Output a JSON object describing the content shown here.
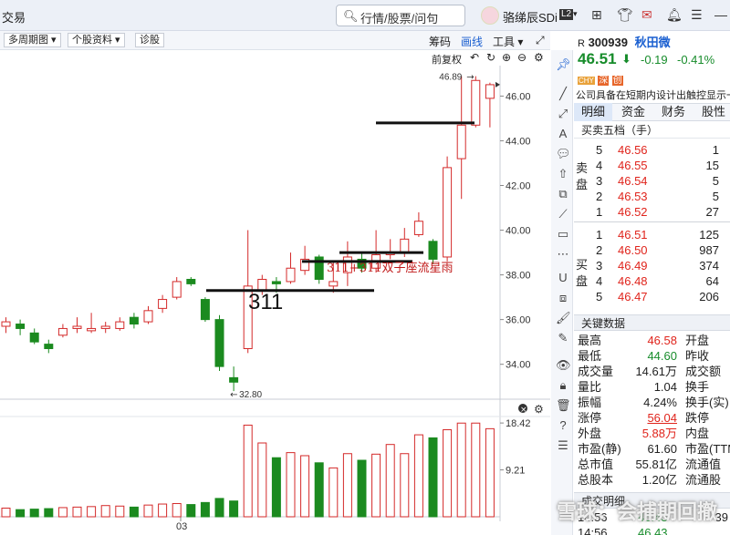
{
  "topbar": {
    "left_label": "交易",
    "search_placeholder": "行情/股票/问句",
    "user_name": "骆绨辰SDi",
    "level_badge": "L2"
  },
  "toolbar": {
    "period_label": "多周期图",
    "stock_info_label": "个股资料",
    "diagnose_label": "诊股",
    "chips_label": "筹码",
    "drawline_label": "画线",
    "tools_label": "工具",
    "fq_label": "前复权"
  },
  "chart_data": {
    "type": "candlestick",
    "y_ticks": [
      "46.00",
      "44.00",
      "42.00",
      "40.00",
      "38.00",
      "36.00",
      "34.00"
    ],
    "ylim": [
      32.6,
      47.2
    ],
    "candles": [
      {
        "o": 35.7,
        "c": 35.9,
        "h": 36.1,
        "l": 35.4
      },
      {
        "o": 35.8,
        "c": 35.6,
        "h": 36.0,
        "l": 35.3
      },
      {
        "o": 35.4,
        "c": 35.0,
        "h": 35.6,
        "l": 34.9
      },
      {
        "o": 34.9,
        "c": 34.7,
        "h": 35.1,
        "l": 34.5
      },
      {
        "o": 35.3,
        "c": 35.6,
        "h": 35.8,
        "l": 35.2
      },
      {
        "o": 35.6,
        "c": 35.7,
        "h": 36.1,
        "l": 35.4
      },
      {
        "o": 35.5,
        "c": 35.6,
        "h": 36.3,
        "l": 35.4
      },
      {
        "o": 35.6,
        "c": 35.7,
        "h": 35.9,
        "l": 35.4
      },
      {
        "o": 35.6,
        "c": 35.9,
        "h": 36.1,
        "l": 35.5
      },
      {
        "o": 36.1,
        "c": 35.8,
        "h": 36.3,
        "l": 35.6
      },
      {
        "o": 35.9,
        "c": 36.4,
        "h": 36.6,
        "l": 35.8
      },
      {
        "o": 36.5,
        "c": 36.9,
        "h": 37.1,
        "l": 36.3
      },
      {
        "o": 37.0,
        "c": 37.7,
        "h": 37.9,
        "l": 36.9
      },
      {
        "o": 37.8,
        "c": 37.6,
        "h": 37.9,
        "l": 37.5
      },
      {
        "o": 36.9,
        "c": 36.0,
        "h": 37.0,
        "l": 35.9
      },
      {
        "o": 36.0,
        "c": 33.9,
        "h": 36.2,
        "l": 33.7
      },
      {
        "o": 33.4,
        "c": 33.2,
        "h": 33.9,
        "l": 32.8
      },
      {
        "o": 34.7,
        "c": 37.5,
        "h": 40.0,
        "l": 34.5
      },
      {
        "o": 37.3,
        "c": 37.8,
        "h": 38.0,
        "l": 37.1
      },
      {
        "o": 37.7,
        "c": 37.6,
        "h": 37.9,
        "l": 37.2
      },
      {
        "o": 37.7,
        "c": 38.3,
        "h": 39.0,
        "l": 37.6
      },
      {
        "o": 38.2,
        "c": 38.7,
        "h": 39.3,
        "l": 38.0
      },
      {
        "o": 38.8,
        "c": 37.8,
        "h": 38.9,
        "l": 37.6
      },
      {
        "o": 37.5,
        "c": 37.7,
        "h": 38.6,
        "l": 37.2
      },
      {
        "o": 38.1,
        "c": 38.8,
        "h": 39.5,
        "l": 37.5
      },
      {
        "o": 38.7,
        "c": 38.3,
        "h": 39.0,
        "l": 38.1
      },
      {
        "o": 38.3,
        "c": 38.9,
        "h": 40.0,
        "l": 38.1
      },
      {
        "o": 38.9,
        "c": 39.0,
        "h": 39.6,
        "l": 38.7
      },
      {
        "o": 39.0,
        "c": 39.6,
        "h": 40.1,
        "l": 38.8
      },
      {
        "o": 39.8,
        "c": 40.4,
        "h": 40.8,
        "l": 39.7
      },
      {
        "o": 39.5,
        "c": 38.7,
        "h": 39.6,
        "l": 38.5
      },
      {
        "o": 38.8,
        "c": 42.8,
        "h": 43.3,
        "l": 38.6
      },
      {
        "o": 43.2,
        "c": 44.7,
        "h": 46.89,
        "l": 41.4
      },
      {
        "o": 44.7,
        "c": 46.7,
        "h": 46.89,
        "l": 44.6
      },
      {
        "o": 45.9,
        "c": 46.51,
        "h": 46.6,
        "l": 44.6
      }
    ],
    "volumes": [
      1.7,
      1.4,
      1.5,
      1.6,
      1.8,
      1.9,
      2.0,
      2.2,
      2.1,
      1.9,
      2.3,
      2.5,
      2.6,
      2.4,
      2.8,
      3.6,
      3.1,
      18.0,
      14.5,
      11.6,
      12.6,
      12.0,
      10.6,
      9.6,
      12.4,
      11.1,
      12.3,
      14.2,
      12.4,
      16.1,
      15.5,
      17.1,
      18.4,
      18.4,
      17.3
    ],
    "volume_ticks": [
      "18.42",
      "9.21"
    ],
    "date_label": "03",
    "high_label": "46.89",
    "low_label": "32.80",
    "support_lines": [
      39.0,
      38.6,
      37.3
    ],
    "resistance_line": 44.8,
    "annotation_big": "311",
    "annotation_small": "311+311双子座流星雨"
  },
  "quote": {
    "prefix": "R",
    "code": "300939",
    "name": "秋田微",
    "price": "46.51",
    "change": "-0.19",
    "change_pct": "-0.41%",
    "tags": [
      "CHY",
      "深",
      "创"
    ],
    "news": "公司具备在短期内设计出触控显示一",
    "tabs": [
      "明细",
      "资金",
      "财务",
      "股性"
    ],
    "order_book_title": "买卖五档（手）",
    "sell_side": "卖盘",
    "buy_side": "买盘",
    "asks": [
      {
        "level": "5",
        "price": "46.56",
        "vol": "1"
      },
      {
        "level": "4",
        "price": "46.55",
        "vol": "15"
      },
      {
        "level": "3",
        "price": "46.54",
        "vol": "5"
      },
      {
        "level": "2",
        "price": "46.53",
        "vol": "5"
      },
      {
        "level": "1",
        "price": "46.52",
        "vol": "27"
      }
    ],
    "bids": [
      {
        "level": "1",
        "price": "46.51",
        "vol": "125"
      },
      {
        "level": "2",
        "price": "46.50",
        "vol": "987"
      },
      {
        "level": "3",
        "price": "46.49",
        "vol": "374"
      },
      {
        "level": "4",
        "price": "46.48",
        "vol": "64"
      },
      {
        "level": "5",
        "price": "46.47",
        "vol": "206"
      }
    ],
    "key_data_title": "关键数据",
    "key_data": [
      {
        "l1": "最高",
        "v1": "46.58",
        "c1": "red",
        "l2": "开盘"
      },
      {
        "l1": "最低",
        "v1": "44.60",
        "c1": "green",
        "l2": "昨收"
      },
      {
        "l1": "成交量",
        "v1": "14.61万",
        "c1": "normal",
        "l2": "成交额"
      },
      {
        "l1": "量比",
        "v1": "1.04",
        "c1": "normal",
        "l2": "换手"
      },
      {
        "l1": "振幅",
        "v1": "4.24%",
        "c1": "normal",
        "l2": "换手(实)"
      },
      {
        "l1": "涨停",
        "v1": "56.04",
        "c1": "red",
        "l2": "跌停"
      },
      {
        "l1": "外盘",
        "v1": "5.88万",
        "c1": "red",
        "l2": "内盘"
      },
      {
        "l1": "市盈(静)",
        "v1": "61.60",
        "c1": "normal",
        "l2": "市盈(TTM"
      },
      {
        "l1": "总市值",
        "v1": "55.81亿",
        "c1": "normal",
        "l2": "流通值"
      },
      {
        "l1": "总股本",
        "v1": "1.20亿",
        "c1": "normal",
        "l2": "流通股"
      }
    ],
    "trades_title": "成交明细",
    "trades": [
      {
        "time": "14:56",
        "price": "46.43",
        "vol": "39"
      },
      {
        "time": "14:56",
        "price": "46.43",
        "vol": ""
      }
    ]
  },
  "watermark": "雪球：会捕期回撤"
}
